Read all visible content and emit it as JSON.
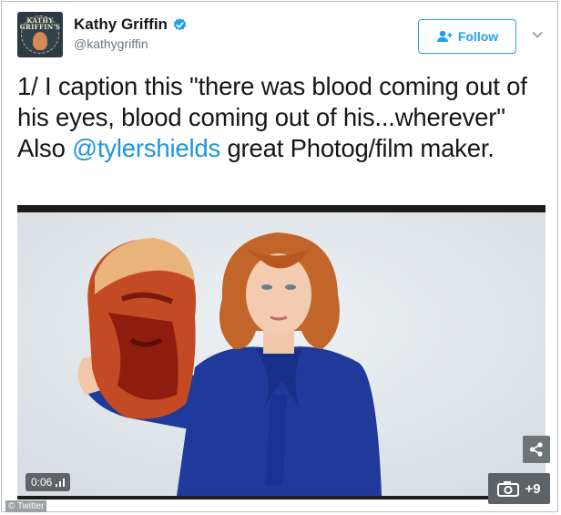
{
  "tweet": {
    "author": {
      "name": "Kathy Griffin",
      "handle": "@kathygriffin",
      "avatar_text": "KATHY GRIFFIN'S"
    },
    "follow_label": "Follow",
    "text_before": "1/ I caption this \"there was blood coming out of his eyes, blood coming out of his...wherever\" Also ",
    "mention": "@tylershields",
    "text_after": " great Photog/film maker."
  },
  "media": {
    "duration": "0:06",
    "gallery_count": "+9",
    "credit": "© Twitter"
  },
  "colors": {
    "accent": "#1da1f2",
    "mention": "#1b95e0",
    "text": "#14171a",
    "muted": "#657786"
  },
  "icons": [
    "verified-icon",
    "follow-user-icon",
    "chevron-down-icon",
    "share-icon",
    "camera-icon",
    "signal-bars-icon"
  ]
}
